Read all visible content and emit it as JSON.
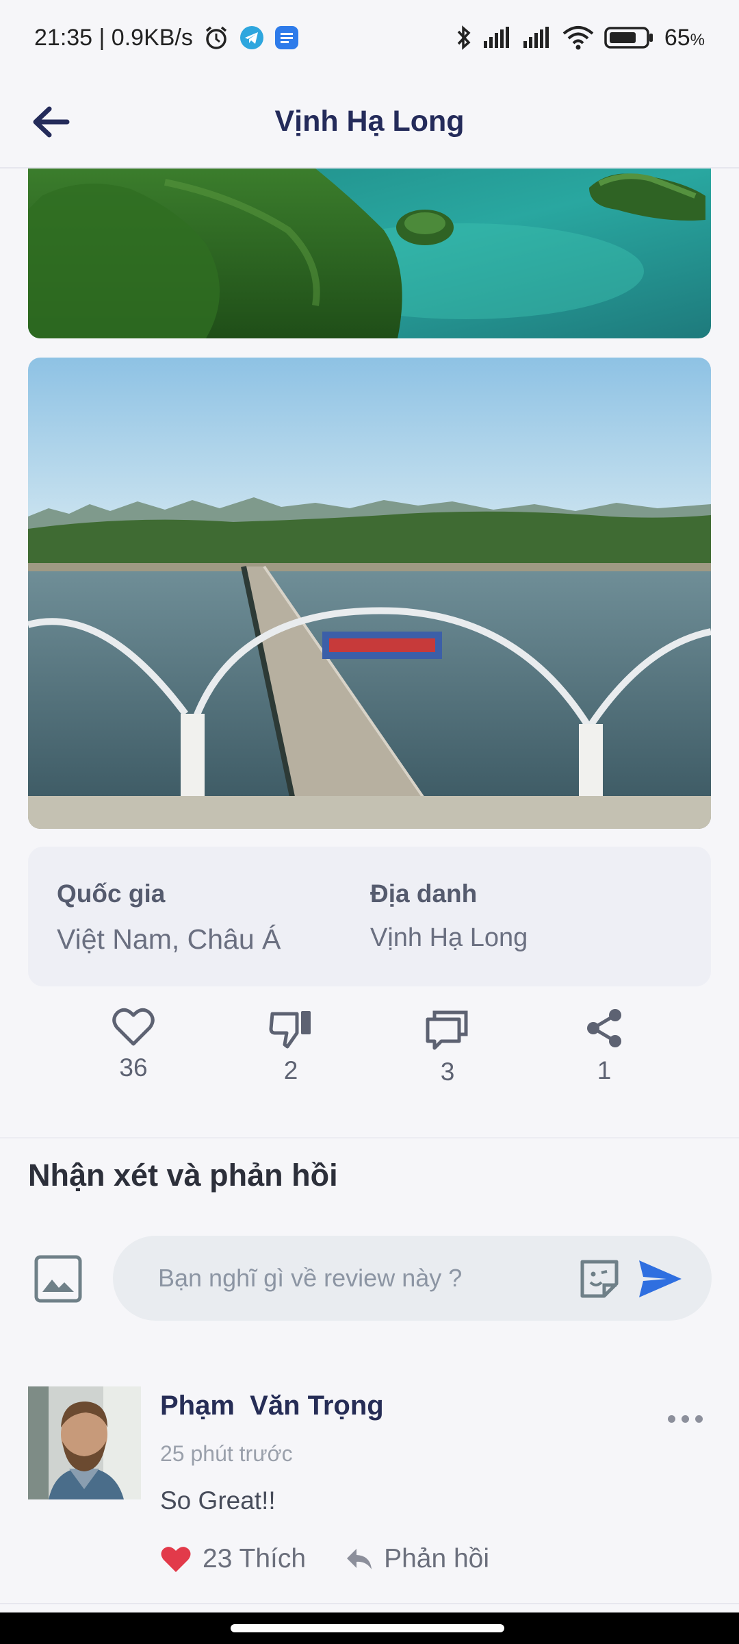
{
  "status_bar": {
    "time_speed": "21:35 | 0.9KB/s",
    "battery": "65",
    "battery_unit": "%"
  },
  "header": {
    "title": "Vịnh Hạ Long"
  },
  "info": {
    "country_label": "Quốc gia",
    "country_value": "Việt Nam, Châu Á",
    "place_label": "Địa danh",
    "place_value": "Vịnh Hạ Long"
  },
  "actions": {
    "likes": "36",
    "dislikes": "2",
    "comments": "3",
    "shares": "1"
  },
  "comments_section": {
    "title": "Nhận xét và phản hồi",
    "input_placeholder": "Bạn nghĩ gì về review này ?"
  },
  "comment": {
    "author": "Phạm  Văn Trọng",
    "time": "25 phút trước",
    "text": "So Great!!",
    "like_label": "23 Thích",
    "reply_label": "Phản hồi"
  },
  "colors": {
    "accent": "#242b5a",
    "send": "#2f6fe0",
    "heart": "#e23a4a"
  }
}
